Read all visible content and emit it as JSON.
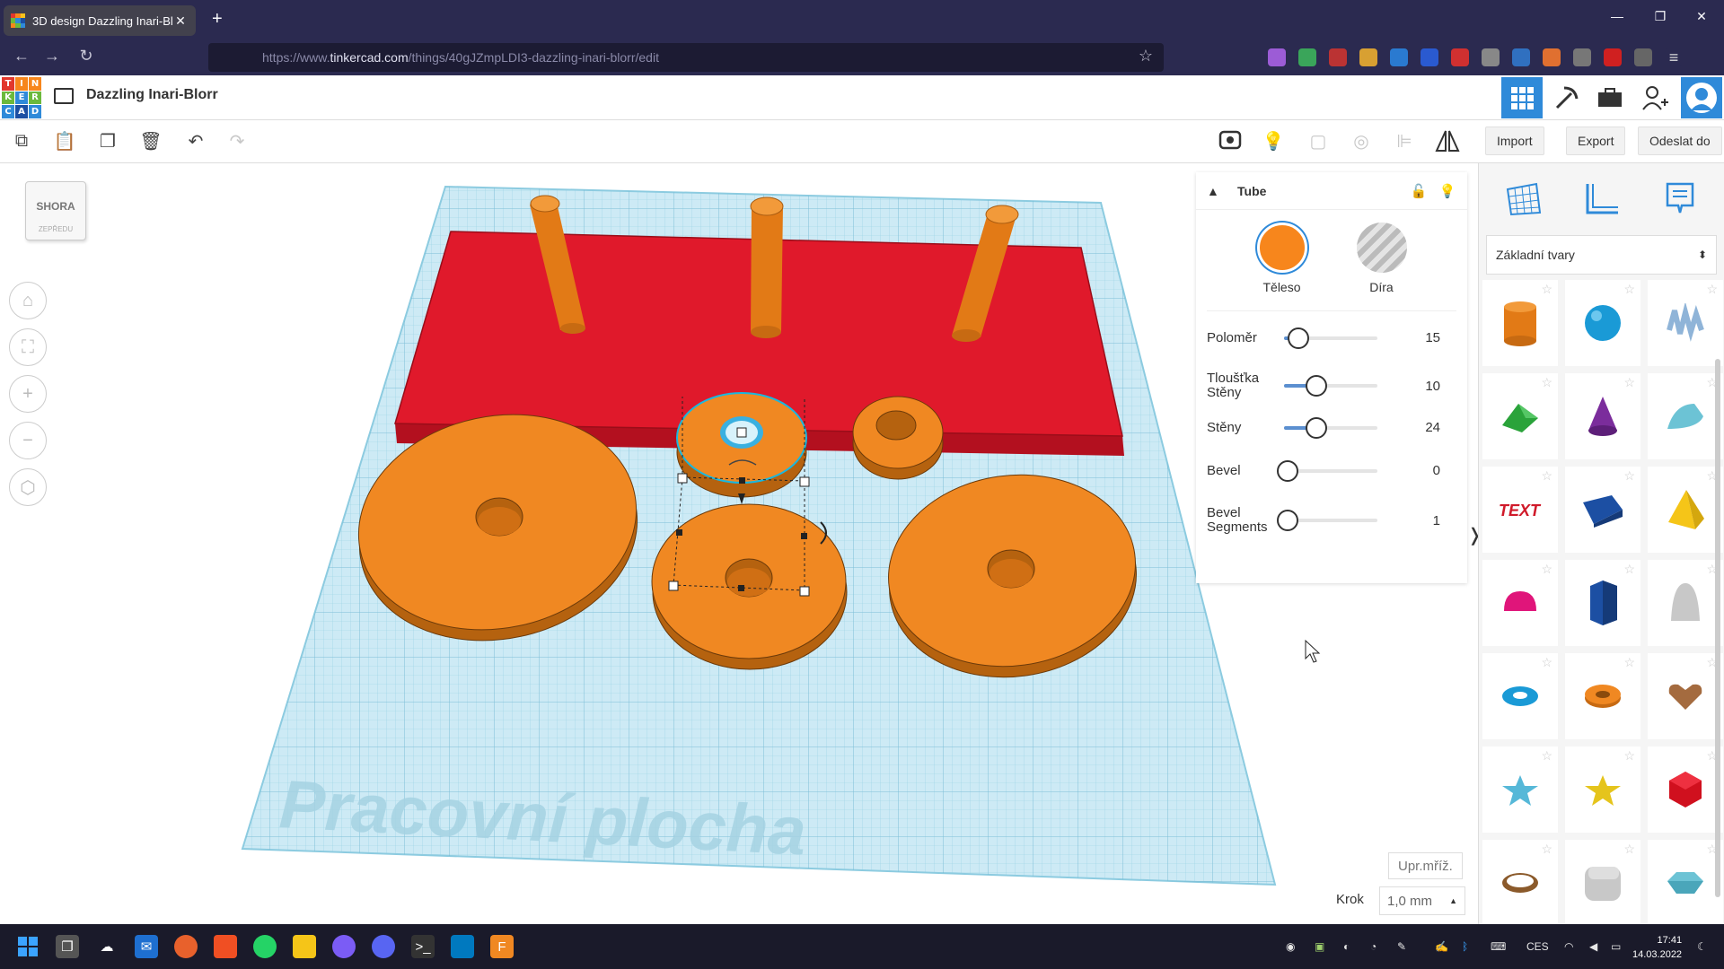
{
  "browser": {
    "tab_title": "3D design Dazzling Inari-Blorr |",
    "url_prefix": "https://www.",
    "url_host": "tinkercad.com",
    "url_path": "/things/40gJZmpLDI3-dazzling-inari-blorr/edit"
  },
  "app": {
    "logo_letters": [
      "T",
      "I",
      "N",
      "K",
      "E",
      "R",
      "C",
      "A",
      "D"
    ],
    "design_title": "Dazzling Inari-Blorr"
  },
  "toolbar": {
    "import_label": "Import",
    "export_label": "Export",
    "send_label": "Odeslat do"
  },
  "viewcube": {
    "top": "SHORA",
    "front": "ZEPŘEDU"
  },
  "workplane": {
    "watermark": "Pracovní plocha"
  },
  "inspector": {
    "title": "Tube",
    "solid_label": "Těleso",
    "hole_label": "Díra",
    "solid_color": "#f7861c",
    "params": [
      {
        "label": "Poloměr",
        "value": "15",
        "fraction": 0.15
      },
      {
        "label": "Tloušťka Stěny",
        "value": "10",
        "fraction": 0.35
      },
      {
        "label": "Stěny",
        "value": "24",
        "fraction": 0.35
      },
      {
        "label": "Bevel",
        "value": "0",
        "fraction": 0.0
      },
      {
        "label": "Bevel Segments",
        "value": "1",
        "fraction": 0.0
      }
    ]
  },
  "shapes_panel": {
    "category": "Základní tvary",
    "shapes": [
      "box-orange-cylinder",
      "sphere",
      "scribble",
      "roof",
      "cone",
      "round-roof",
      "text",
      "box",
      "pyramid",
      "half-sphere",
      "polygon",
      "paraboloid",
      "torus",
      "tube",
      "heart",
      "star",
      "star-gold",
      "icosahedron",
      "ring",
      "cube-rounded",
      "gem"
    ]
  },
  "bottom": {
    "grid_label": "Upr.mříž.",
    "step_label": "Krok",
    "step_value": "1,0 mm"
  },
  "taskbar": {
    "lang": "CES",
    "time": "17:41",
    "date": "14.03.2022"
  },
  "colors": {
    "orange": "#f7861c",
    "red_base": "#e0192b",
    "grid_blue": "#a8dcec",
    "accent_blue": "#2f8ad9"
  }
}
